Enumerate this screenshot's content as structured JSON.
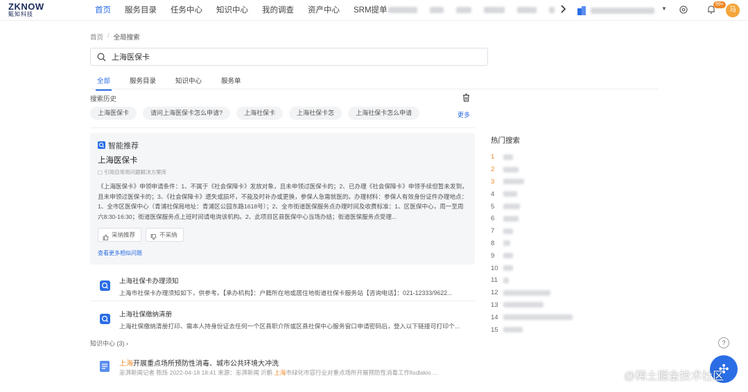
{
  "logo": {
    "main": "ZKNOW",
    "sub": "甄知科技"
  },
  "nav": {
    "items": [
      "首页",
      "服务目录",
      "任务中心",
      "知识中心",
      "我的调查",
      "资产中心",
      "SRM提单"
    ],
    "active_index": 0,
    "notification_badge": "99+",
    "avatar_text": "马"
  },
  "breadcrumb": {
    "home": "首页",
    "separator": "/",
    "current": "全局搜索"
  },
  "search": {
    "value": "上海医保卡"
  },
  "tabs": [
    "全部",
    "服务目录",
    "知识中心",
    "服务单"
  ],
  "history": {
    "title": "搜索历史",
    "chips": [
      "上海医保卡",
      "请问上海医保卡怎么申请?",
      "上海社保卡",
      "上海社保卡怎",
      "上海社保卡怎么申请"
    ],
    "more": "更多"
  },
  "recommendation": {
    "label": "智能推荐",
    "title": "上海医保卡",
    "source": "引用自常用问题解决方案库",
    "body": "《上海医保卡》申领申请条件：1、不属于《社会保障卡》发放对象，且未申领过医保卡的；2、已办理《社会保障卡》申领手续但暂未发到，且未申领过医保卡的；3、《社会保障卡》遗失或损坏，不能及时补办或更换，参保人急需就医的。办理材料：参保人有效身份证件办理地点：1、全市区医保中心（青浦社保局地址：青浦区公园东路1618号）；2、全市街道医保服务点办理时间及收费标准：1、区医保中心，周一至周六8:30-16:30；街道医保服务点上班时间请电询该机构。2、此项目区县医保中心当场办结；街道医保服务点受理...",
    "adopt": "采纳推荐",
    "reject": "不采纳",
    "more_link": "查看更多相似问题"
  },
  "results": [
    {
      "title": "上海社保卡办理须知",
      "desc": "上海市社保卡办理须知如下，供参考。【承办机构】：户籍所在地或居住地街道社保卡服务站【咨询电话】：021-12333/9622..."
    },
    {
      "title": "上海社保缴纳清册",
      "desc": "上海社保缴纳清册打印、需本人持身份证去任何一个区县职介所或区县社保中心服务窗口申请密码后，登入以下链接可打印个..."
    }
  ],
  "knowledge_center": {
    "label": "知识中心 (3)",
    "arrow": "›"
  },
  "article": {
    "title_hl": "上海",
    "title_rest": "开展重点场所预防性消毒、城市公共环境大冲洗",
    "meta_prefix": "澎湃新闻记者 陈烁 2022-04-18 18:41 来源：澎湃新闻 沂鹏 ",
    "meta_hl": "上海",
    "meta_rest": "市绿化市容行业对重点场所开展预防性消毒工作fisdlakio ..."
  },
  "hot": {
    "title": "热门搜索",
    "ranks": [
      "1",
      "2",
      "3",
      "4",
      "5",
      "6",
      "7",
      "8",
      "9",
      "10",
      "11",
      "12",
      "13",
      "14",
      "15"
    ]
  },
  "floating": {
    "help": "?",
    "main": "✣"
  },
  "watermark": "@稀土掘金技术社区",
  "colors": {
    "accent": "#2b6de5",
    "highlight": "#f08a2a"
  }
}
